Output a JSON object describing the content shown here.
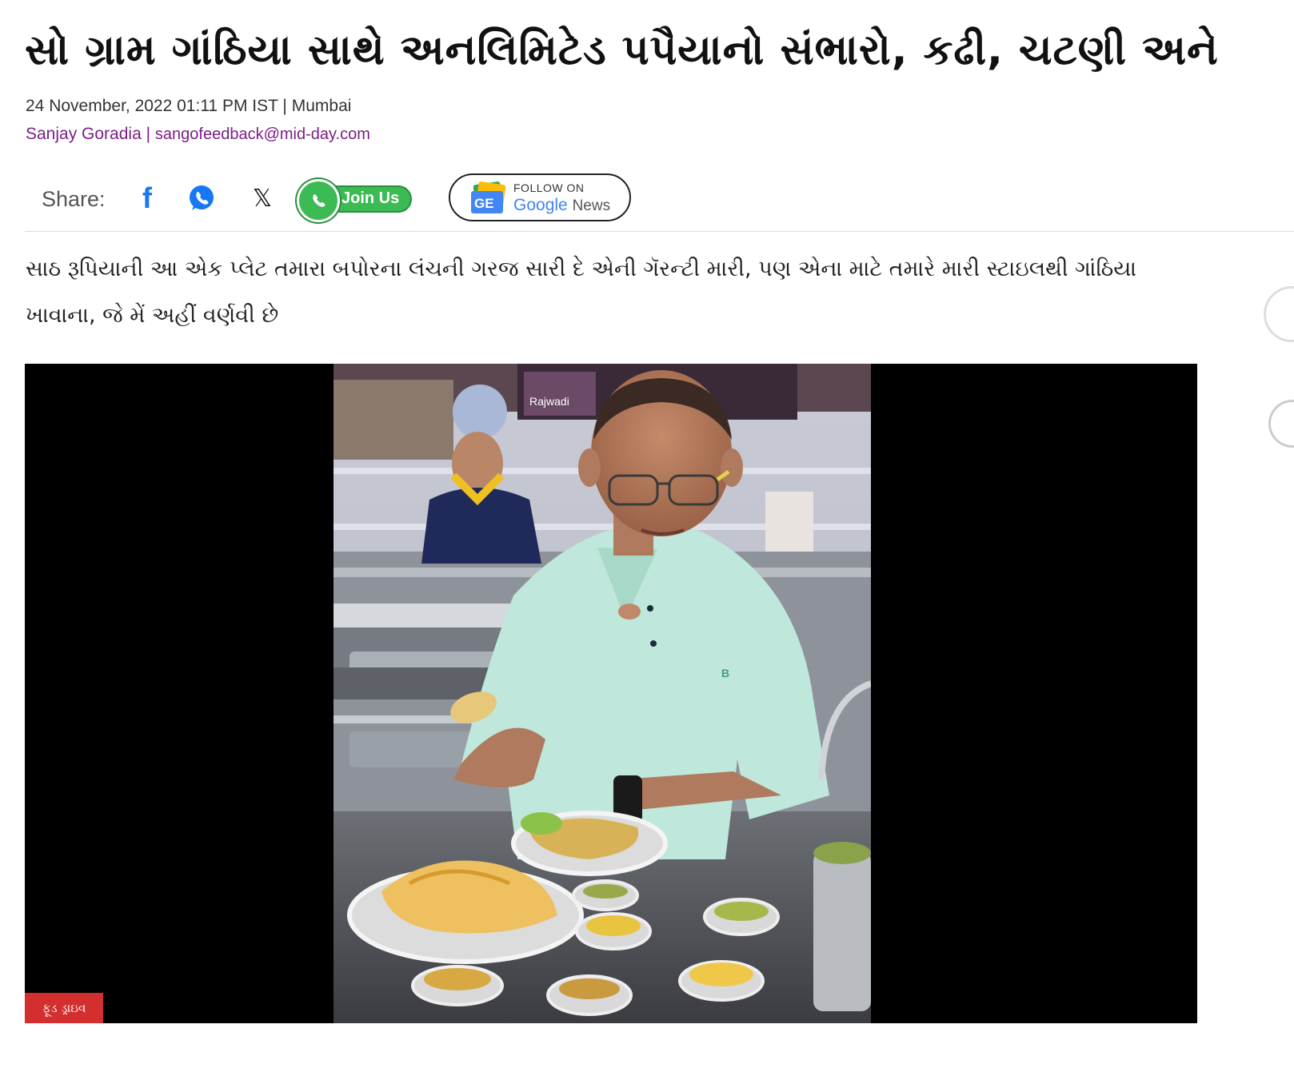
{
  "article": {
    "title": "સો ગ્રામ ગાંઠિયા સાથે અનલિમિટેડ પપૈયાનો સંભારો, કઢી, ચટણી અને",
    "date": "24 November, 2022 01:11 PM IST",
    "location": "Mumbai",
    "author": "Sanjay Goradia",
    "email": "sangofeedback@mid-day.com",
    "summary": "સાઠ રૂપિયાની આ એક પ્લેટ તમારા બપોરના લંચની ગરજ સારી દે એની ગૅરન્ટી મારી, પણ એના માટે તમારે મારી સ્ટાઇલથી ગાંઠિયા ખાવાના, જે મેં અહીં વર્ણવી છે",
    "separator": "|",
    "category_badge": "ફૂડ ડ્રાઇવ"
  },
  "share": {
    "label": "Share:",
    "facebook_icon": "f",
    "x_icon": "𝕏",
    "join_label": "Join Us",
    "gnews_follow": "FOLLOW ON",
    "gnews_google": "Google",
    "gnews_news": "News",
    "gnews_logo_text": "GE"
  },
  "photo": {
    "shirt_logo": "B",
    "sign_text": "Rajwadi"
  },
  "colors": {
    "author": "#7b1e86",
    "badge": "#d32f2f",
    "whatsapp": "#3cba54",
    "facebook": "#1877f2"
  }
}
